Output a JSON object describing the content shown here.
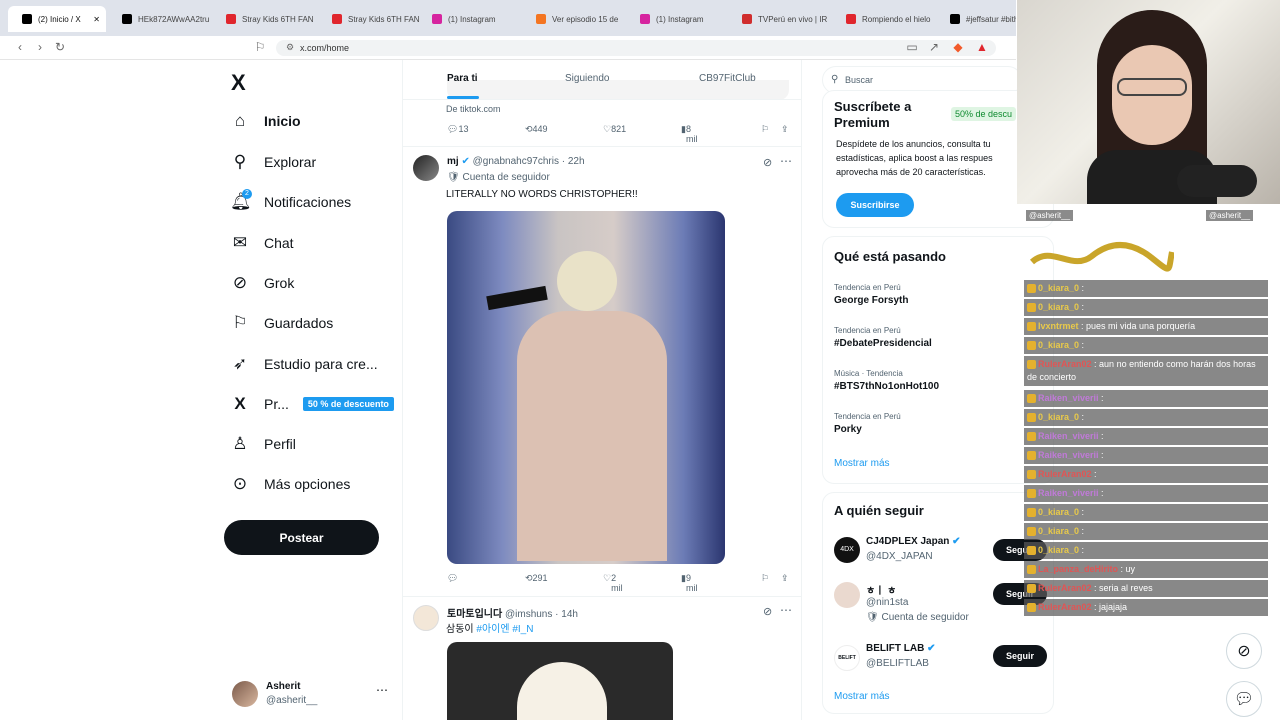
{
  "browser": {
    "tabs": [
      {
        "label": "(2) Inicio / X",
        "color": "#000000"
      },
      {
        "label": "HEk872AWwAA2tru",
        "color": "#000000"
      },
      {
        "label": "Stray Kids 6TH FAN",
        "color": "#e0262d"
      },
      {
        "label": "Stray Kids 6TH FAN",
        "color": "#e0262d"
      },
      {
        "label": "(1) Instagram",
        "color": "#d6249f"
      },
      {
        "label": "Ver episodio 15 de",
        "color": "#f47521"
      },
      {
        "label": "(1) Instagram",
        "color": "#d6249f"
      },
      {
        "label": "TVPerú en vivo | IR",
        "color": "#d02d2d"
      },
      {
        "label": "Rompiendo el hielo",
        "color": "#e0262d"
      },
      {
        "label": "#jeffsatur #bith",
        "color": "#000000"
      }
    ],
    "url": "x.com/home"
  },
  "sidebar": {
    "logo": "X",
    "items": [
      {
        "label": "Inicio",
        "icon": "home-icon"
      },
      {
        "label": "Explorar",
        "icon": "search-icon"
      },
      {
        "label": "Notificaciones",
        "icon": "bell-icon",
        "badge": "2"
      },
      {
        "label": "Chat",
        "icon": "mail-icon"
      },
      {
        "label": "Grok",
        "icon": "grok-icon"
      },
      {
        "label": "Guardados",
        "icon": "bookmark-icon"
      },
      {
        "label": "Estudio para cre...",
        "icon": "rocket-icon"
      },
      {
        "label": "Pr...",
        "icon": "x-premium-icon"
      },
      {
        "label": "Perfil",
        "icon": "person-icon"
      },
      {
        "label": "Más opciones",
        "icon": "more-circle-icon"
      }
    ],
    "premium_badge": "50 % de descuento",
    "post_button": "Postear",
    "account": {
      "name": "Asherit",
      "handle": "@asherit__"
    }
  },
  "feed": {
    "tabs": [
      "Para ti",
      "Siguiendo",
      "CB97FitClub"
    ],
    "tweet1": {
      "source": "De tiktok.com",
      "replies": "13",
      "reposts": "449",
      "likes": "821",
      "views": "8 mil"
    },
    "tweet2": {
      "name": "mj",
      "handle": "@gnabnahc97chris",
      "time": "· 22h",
      "badge": "Cuenta de seguidor",
      "text": "LITERALLY NO WORDS CHRISTOPHER!!",
      "replies": "",
      "reposts": "291",
      "likes": "2 mil",
      "views": "9 mil"
    },
    "tweet3": {
      "name": "토마토입니다",
      "handle": "@imshuns",
      "time": "· 14h",
      "text_plain": "삼동이 ",
      "hashtags": "#아이엔 #I_N"
    }
  },
  "right": {
    "search_placeholder": "Buscar",
    "premium": {
      "title": "Suscríbete a Premium",
      "discount": "50% de descu",
      "body": "Despídete de los anuncios, consulta tu estadísticas, aplica boost a las respues aprovecha más de 20 características.",
      "button": "Suscribirse"
    },
    "trends": {
      "title": "Qué está pasando",
      "items": [
        {
          "meta": "Tendencia en Perú",
          "name": "George Forsyth"
        },
        {
          "meta": "Tendencia en Perú",
          "name": "#DebatePresidencial"
        },
        {
          "meta": "Música · Tendencia",
          "name": "#BTS7thNo1onHot100"
        },
        {
          "meta": "Tendencia en Perú",
          "name": "Porky"
        }
      ],
      "more": "Mostrar más"
    },
    "follow": {
      "title": "A quién seguir",
      "items": [
        {
          "name": "CJ4DPLEX Japan",
          "handle": "@4DX_JAPAN",
          "sub": ""
        },
        {
          "name": "ㅎㅣ ㅎ",
          "handle": "@nin1sta",
          "sub": "Cuenta de seguidor"
        },
        {
          "name": "BELIFT LAB",
          "handle": "@BELIFTLAB",
          "sub": ""
        }
      ],
      "button": "Seguir",
      "more": "Mostrar más"
    }
  },
  "stream": {
    "overlay_tags": [
      "@asherit__",
      "@asherit__"
    ],
    "chat": [
      {
        "user": "0_kiara_0",
        "msg": "",
        "cls": ""
      },
      {
        "user": "0_kiara_0",
        "msg": "",
        "cls": ""
      },
      {
        "user": "Ivxntrmet",
        "msg": "pues mi vida una porquería",
        "cls": ""
      },
      {
        "user": "0_kiara_0",
        "msg": "",
        "cls": ""
      },
      {
        "user": "RulerAran02",
        "msg": "aun no entiendo como harán dos horas de concierto",
        "cls": "r"
      },
      {
        "user": "Raiken_viverii",
        "msg": "",
        "cls": "p"
      },
      {
        "user": "0_kiara_0",
        "msg": "",
        "cls": ""
      },
      {
        "user": "Raiken_viverii",
        "msg": "",
        "cls": "p"
      },
      {
        "user": "Raiken_viverii",
        "msg": "",
        "cls": "p"
      },
      {
        "user": "RulerAran02",
        "msg": "",
        "cls": "r"
      },
      {
        "user": "Raiken_viverii",
        "msg": "",
        "cls": "p"
      },
      {
        "user": "0_kiara_0",
        "msg": "",
        "cls": ""
      },
      {
        "user": "0_kiara_0",
        "msg": "",
        "cls": ""
      },
      {
        "user": "0_kiara_0",
        "msg": "",
        "cls": ""
      },
      {
        "user": "La_panza_deHirito",
        "msg": "uy",
        "cls": "r"
      },
      {
        "user": "RulerAran02",
        "msg": "seria al reves",
        "cls": "r"
      },
      {
        "user": "RulerAran02",
        "msg": "jajajaja",
        "cls": "r"
      }
    ]
  }
}
